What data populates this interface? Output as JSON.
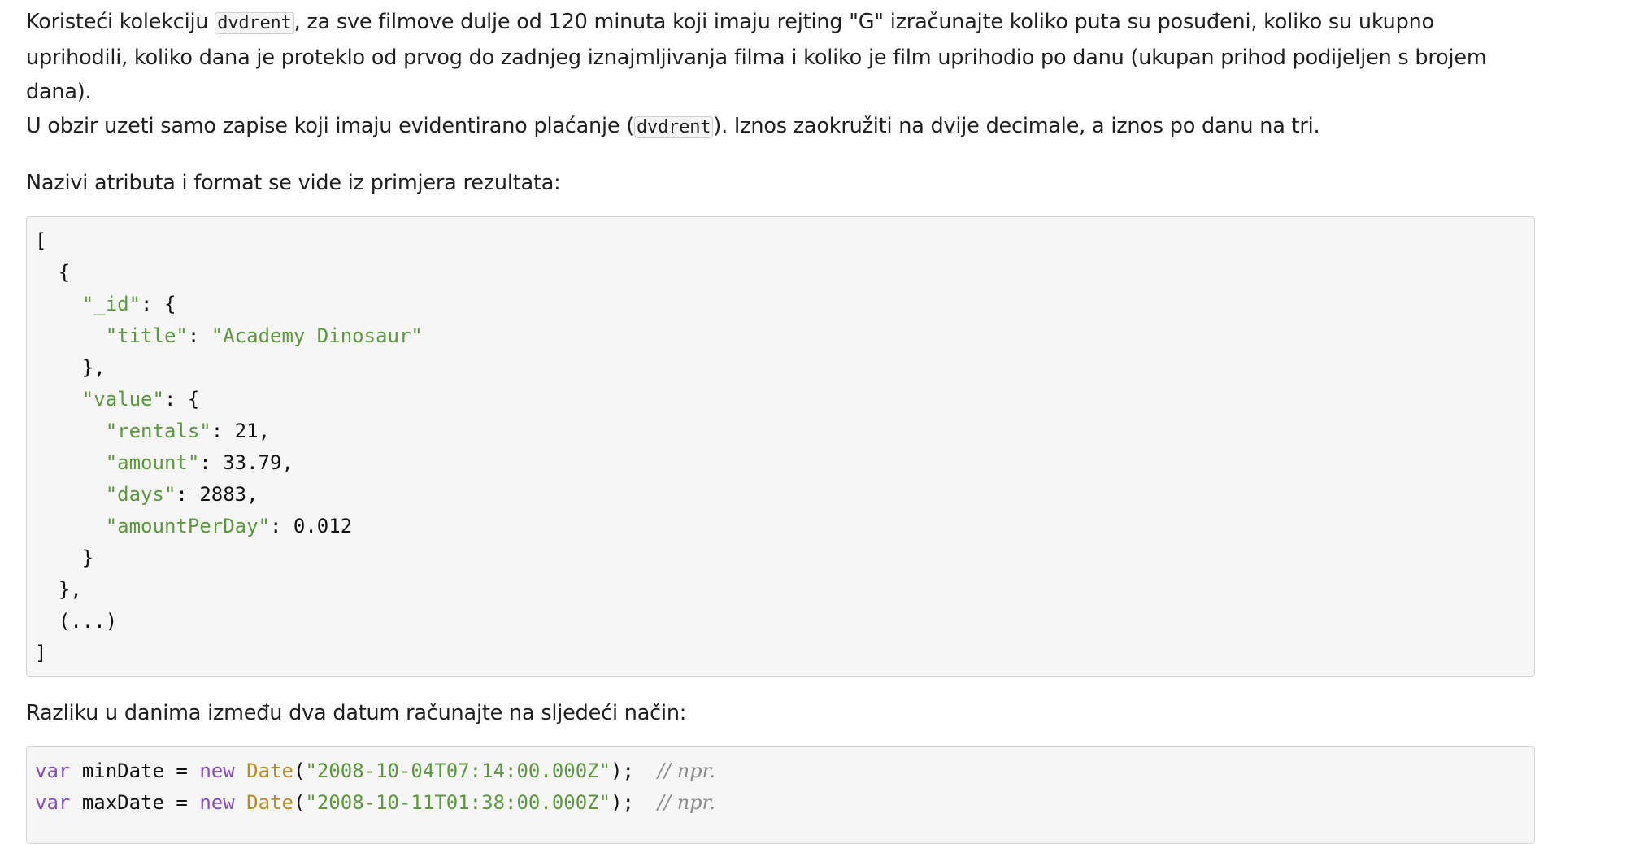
{
  "intro": {
    "p1_part1": "Koristeći kolekciju ",
    "p1_code": "dvdrent",
    "p1_part2": ", za sve filmove dulje od 120 minuta koji imaju rejting \"G\" izračunajte koliko puta su posuđeni, koliko su ukupno uprihodili, koliko dana je proteklo od prvog do zadnjeg iznajmljivanja filma i koliko je film uprihodio po danu (ukupan prihod podijeljen s brojem dana).",
    "p2_part1": "U obzir uzeti samo zapise koji imaju evidentirano plaćanje (",
    "p2_code": "dvdrent",
    "p2_part2": "). Iznos zaokružiti na dvije decimale, a iznos po danu na tri.",
    "p3": "Nazivi atributa i format se vide iz primjera rezultata:"
  },
  "json_example": {
    "open_bracket": "[",
    "open_obj": "  {",
    "id_key": "\"_id\"",
    "title_key": "\"title\"",
    "title_value": "\"Academy Dinosaur\"",
    "close_id": "    },",
    "value_key": "\"value\"",
    "rentals_key": "\"rentals\"",
    "rentals_value": "21",
    "amount_key": "\"amount\"",
    "amount_value": "33.79",
    "days_key": "\"days\"",
    "days_value": "2883",
    "apd_key": "\"amountPerDay\"",
    "apd_value": "0.012",
    "close_value": "    }",
    "close_obj": "  },",
    "ellipsis": "  (...)",
    "close_bracket": "]"
  },
  "p4": "Razliku u danima između dva datum računajte na sljedeći način:",
  "js_example": {
    "kw_var": "var",
    "min_name": "minDate",
    "max_name": "maxDate",
    "eq": " = ",
    "kw_new": "new",
    "cls_date": "Date",
    "min_str": "\"2008-10-04T07:14:00.000Z\"",
    "max_str": "\"2008-10-11T01:38:00.000Z\"",
    "tail": ");",
    "comment": "// npr."
  }
}
